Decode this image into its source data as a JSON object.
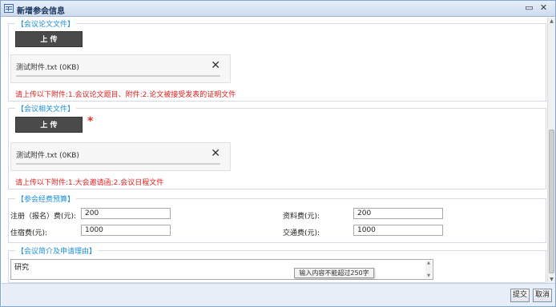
{
  "window": {
    "title": "新增参会信息"
  },
  "sections": {
    "paper": {
      "legend": "【会议论文文件】",
      "upload_label": "上 传",
      "file": {
        "name": "测试附件.txt (0KB)",
        "delete_glyph": "✕"
      },
      "hint": "请上传以下附件:1.会议论文题目、附件:2.论文被接受发表的证明文件"
    },
    "related": {
      "legend": "【会议相关文件】",
      "upload_label": "上 传",
      "required_mark": "*",
      "file": {
        "name": "测试附件.txt (0KB)",
        "delete_glyph": "✕"
      },
      "hint": "请上传以下附件:1.大会邀请函;2.会议日程文件"
    },
    "budget": {
      "legend": "【参会经费预算】",
      "registration_label": "注册（报名）费(元):",
      "registration_value": "200",
      "materials_label": "资料费(元):",
      "materials_value": "200",
      "lodging_label": "住宿费(元):",
      "lodging_value": "1000",
      "transport_label": "交通费(元):",
      "transport_value": "1000"
    },
    "intro": {
      "legend": "【会议简介及申请理由】",
      "text": "研究",
      "tooltip": "输入内容不能超过250字"
    }
  },
  "footer": {
    "submit_label": "提交",
    "cancel_label": "取消"
  },
  "icons": {
    "title": "form-window-icon",
    "minimize": "minimize-icon",
    "close": "close-icon",
    "delete": "delete-file-icon"
  },
  "colors": {
    "legend": "#1c8fd6",
    "hint": "#e02020",
    "upload_button": "#4a4a4a",
    "titlebar": "#cfdcee"
  }
}
